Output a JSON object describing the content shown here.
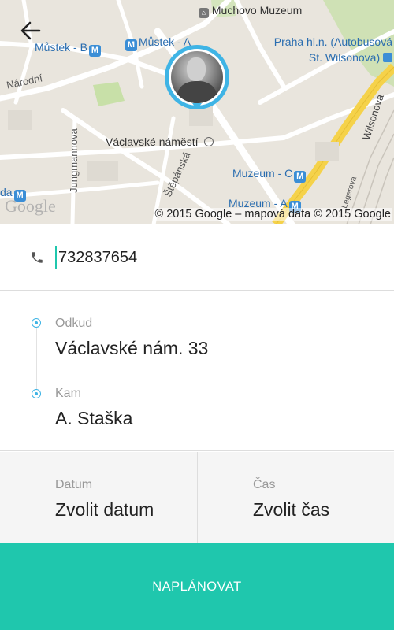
{
  "map": {
    "labels": {
      "muchovo": "Muchovo Muzeum",
      "mustek_b": "Můstek - B",
      "mustek_a": "Můstek - A",
      "praha_hl_1": "Praha hl.n. (Autobusová",
      "praha_hl_2": "St. Wilsonova)",
      "narodni": "Národní",
      "vaclavske": "Václavské náměstí",
      "jungmannova": "Jungmannova",
      "stepanska": "Štěpánská",
      "muzeum_c": "Muzeum - C",
      "muzeum_a": "Muzeum - A",
      "wilsonova": "Wilsonova",
      "legerova": "Legerova",
      "da": "da"
    },
    "metro_letter": "M",
    "google_logo": "Google",
    "copyright": "© 2015 Google – mapová data © 2015 Google"
  },
  "phone": {
    "value": "732837654"
  },
  "route": {
    "from_label": "Odkud",
    "from_value": "Václavské nám. 33",
    "to_label": "Kam",
    "to_value": "A. Staška"
  },
  "datetime": {
    "date_label": "Datum",
    "date_value": "Zvolit datum",
    "time_label": "Čas",
    "time_value": "Zvolit čas"
  },
  "submit_label": "NAPLÁNOVAT",
  "colors": {
    "accent": "#1fc7ad",
    "pin": "#3fb4e5",
    "metro": "#3b8ed6",
    "road_yellow": "#f5d24a"
  }
}
